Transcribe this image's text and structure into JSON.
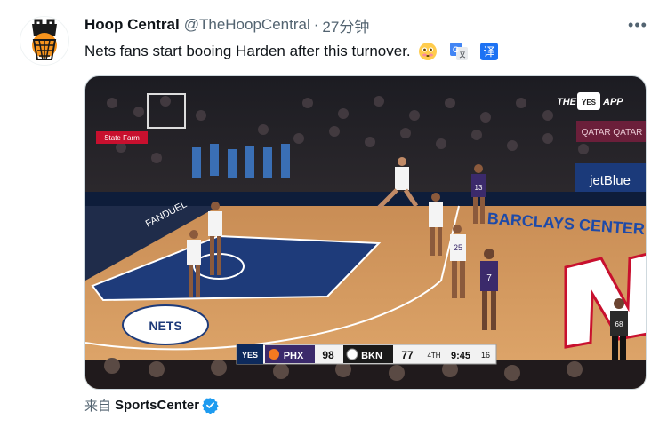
{
  "tweet": {
    "display_name": "Hoop Central",
    "handle": "@TheHoopCentral",
    "separator": "·",
    "time": "27分钟",
    "text": "Nets fans start booing Harden after this turnover.",
    "more_label": "•••"
  },
  "video": {
    "watermark_the": "THE",
    "watermark_app": "APP",
    "watermark_yes": "YES",
    "ad_statefarm": "State Farm",
    "ad_fanduel": "FANDUEL",
    "ad_jetblue": "jetBlue",
    "ad_qatar": "QATAR QATAR",
    "court_text": "BARCLAYS CENTER",
    "logo_text": "NETS",
    "scorebug": {
      "network": "YES",
      "away_team": "PHX",
      "away_score": "98",
      "home_team": "BKN",
      "home_score": "77",
      "quarter": "4TH",
      "clock": "9:45",
      "shot_clock": "16"
    },
    "jerseys": [
      "25",
      "7",
      "13",
      "68"
    ]
  },
  "source": {
    "prefix": "来自",
    "name": "SportsCenter"
  },
  "colors": {
    "handle_gray": "#536471",
    "verified_blue": "#1d9bf0",
    "court_wood": "#d9a066",
    "nets_black": "#000000",
    "suns_purple": "#3b2a6b",
    "jersey_white": "#f4f4f4"
  }
}
